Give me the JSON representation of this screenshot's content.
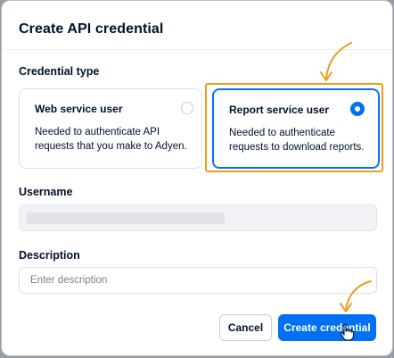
{
  "dialog": {
    "title": "Create API credential"
  },
  "credential_type": {
    "label": "Credential type",
    "options": [
      {
        "title": "Web service user",
        "description": "Needed to authenticate API requests that you make to Adyen.",
        "selected": false
      },
      {
        "title": "Report service user",
        "description": "Needed to authenticate requests to download reports.",
        "selected": true
      }
    ]
  },
  "username": {
    "label": "Username",
    "value": ""
  },
  "description": {
    "label": "Description",
    "placeholder": "Enter description",
    "value": ""
  },
  "actions": {
    "cancel_label": "Cancel",
    "create_label": "Create credential"
  },
  "colors": {
    "accent": "#0070f5",
    "annotation": "#f39a1c",
    "text": "#00112c"
  },
  "icons": {
    "annotation_arrow": "curved-arrow-icon",
    "cursor": "hand-pointer-icon"
  }
}
